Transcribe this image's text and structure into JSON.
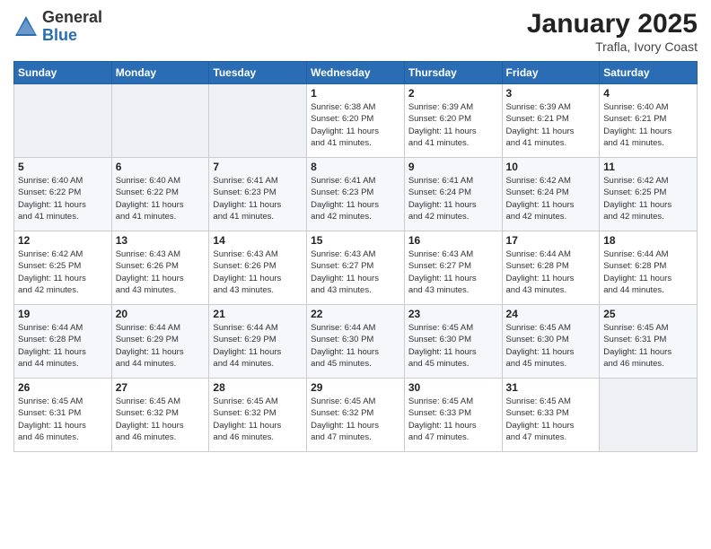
{
  "logo": {
    "general": "General",
    "blue": "Blue"
  },
  "header": {
    "title": "January 2025",
    "subtitle": "Trafla, Ivory Coast"
  },
  "weekdays": [
    "Sunday",
    "Monday",
    "Tuesday",
    "Wednesday",
    "Thursday",
    "Friday",
    "Saturday"
  ],
  "weeks": [
    [
      {
        "day": "",
        "info": ""
      },
      {
        "day": "",
        "info": ""
      },
      {
        "day": "",
        "info": ""
      },
      {
        "day": "1",
        "info": "Sunrise: 6:38 AM\nSunset: 6:20 PM\nDaylight: 11 hours\nand 41 minutes."
      },
      {
        "day": "2",
        "info": "Sunrise: 6:39 AM\nSunset: 6:20 PM\nDaylight: 11 hours\nand 41 minutes."
      },
      {
        "day": "3",
        "info": "Sunrise: 6:39 AM\nSunset: 6:21 PM\nDaylight: 11 hours\nand 41 minutes."
      },
      {
        "day": "4",
        "info": "Sunrise: 6:40 AM\nSunset: 6:21 PM\nDaylight: 11 hours\nand 41 minutes."
      }
    ],
    [
      {
        "day": "5",
        "info": "Sunrise: 6:40 AM\nSunset: 6:22 PM\nDaylight: 11 hours\nand 41 minutes."
      },
      {
        "day": "6",
        "info": "Sunrise: 6:40 AM\nSunset: 6:22 PM\nDaylight: 11 hours\nand 41 minutes."
      },
      {
        "day": "7",
        "info": "Sunrise: 6:41 AM\nSunset: 6:23 PM\nDaylight: 11 hours\nand 41 minutes."
      },
      {
        "day": "8",
        "info": "Sunrise: 6:41 AM\nSunset: 6:23 PM\nDaylight: 11 hours\nand 42 minutes."
      },
      {
        "day": "9",
        "info": "Sunrise: 6:41 AM\nSunset: 6:24 PM\nDaylight: 11 hours\nand 42 minutes."
      },
      {
        "day": "10",
        "info": "Sunrise: 6:42 AM\nSunset: 6:24 PM\nDaylight: 11 hours\nand 42 minutes."
      },
      {
        "day": "11",
        "info": "Sunrise: 6:42 AM\nSunset: 6:25 PM\nDaylight: 11 hours\nand 42 minutes."
      }
    ],
    [
      {
        "day": "12",
        "info": "Sunrise: 6:42 AM\nSunset: 6:25 PM\nDaylight: 11 hours\nand 42 minutes."
      },
      {
        "day": "13",
        "info": "Sunrise: 6:43 AM\nSunset: 6:26 PM\nDaylight: 11 hours\nand 43 minutes."
      },
      {
        "day": "14",
        "info": "Sunrise: 6:43 AM\nSunset: 6:26 PM\nDaylight: 11 hours\nand 43 minutes."
      },
      {
        "day": "15",
        "info": "Sunrise: 6:43 AM\nSunset: 6:27 PM\nDaylight: 11 hours\nand 43 minutes."
      },
      {
        "day": "16",
        "info": "Sunrise: 6:43 AM\nSunset: 6:27 PM\nDaylight: 11 hours\nand 43 minutes."
      },
      {
        "day": "17",
        "info": "Sunrise: 6:44 AM\nSunset: 6:28 PM\nDaylight: 11 hours\nand 43 minutes."
      },
      {
        "day": "18",
        "info": "Sunrise: 6:44 AM\nSunset: 6:28 PM\nDaylight: 11 hours\nand 44 minutes."
      }
    ],
    [
      {
        "day": "19",
        "info": "Sunrise: 6:44 AM\nSunset: 6:28 PM\nDaylight: 11 hours\nand 44 minutes."
      },
      {
        "day": "20",
        "info": "Sunrise: 6:44 AM\nSunset: 6:29 PM\nDaylight: 11 hours\nand 44 minutes."
      },
      {
        "day": "21",
        "info": "Sunrise: 6:44 AM\nSunset: 6:29 PM\nDaylight: 11 hours\nand 44 minutes."
      },
      {
        "day": "22",
        "info": "Sunrise: 6:44 AM\nSunset: 6:30 PM\nDaylight: 11 hours\nand 45 minutes."
      },
      {
        "day": "23",
        "info": "Sunrise: 6:45 AM\nSunset: 6:30 PM\nDaylight: 11 hours\nand 45 minutes."
      },
      {
        "day": "24",
        "info": "Sunrise: 6:45 AM\nSunset: 6:30 PM\nDaylight: 11 hours\nand 45 minutes."
      },
      {
        "day": "25",
        "info": "Sunrise: 6:45 AM\nSunset: 6:31 PM\nDaylight: 11 hours\nand 46 minutes."
      }
    ],
    [
      {
        "day": "26",
        "info": "Sunrise: 6:45 AM\nSunset: 6:31 PM\nDaylight: 11 hours\nand 46 minutes."
      },
      {
        "day": "27",
        "info": "Sunrise: 6:45 AM\nSunset: 6:32 PM\nDaylight: 11 hours\nand 46 minutes."
      },
      {
        "day": "28",
        "info": "Sunrise: 6:45 AM\nSunset: 6:32 PM\nDaylight: 11 hours\nand 46 minutes."
      },
      {
        "day": "29",
        "info": "Sunrise: 6:45 AM\nSunset: 6:32 PM\nDaylight: 11 hours\nand 47 minutes."
      },
      {
        "day": "30",
        "info": "Sunrise: 6:45 AM\nSunset: 6:33 PM\nDaylight: 11 hours\nand 47 minutes."
      },
      {
        "day": "31",
        "info": "Sunrise: 6:45 AM\nSunset: 6:33 PM\nDaylight: 11 hours\nand 47 minutes."
      },
      {
        "day": "",
        "info": ""
      }
    ]
  ]
}
